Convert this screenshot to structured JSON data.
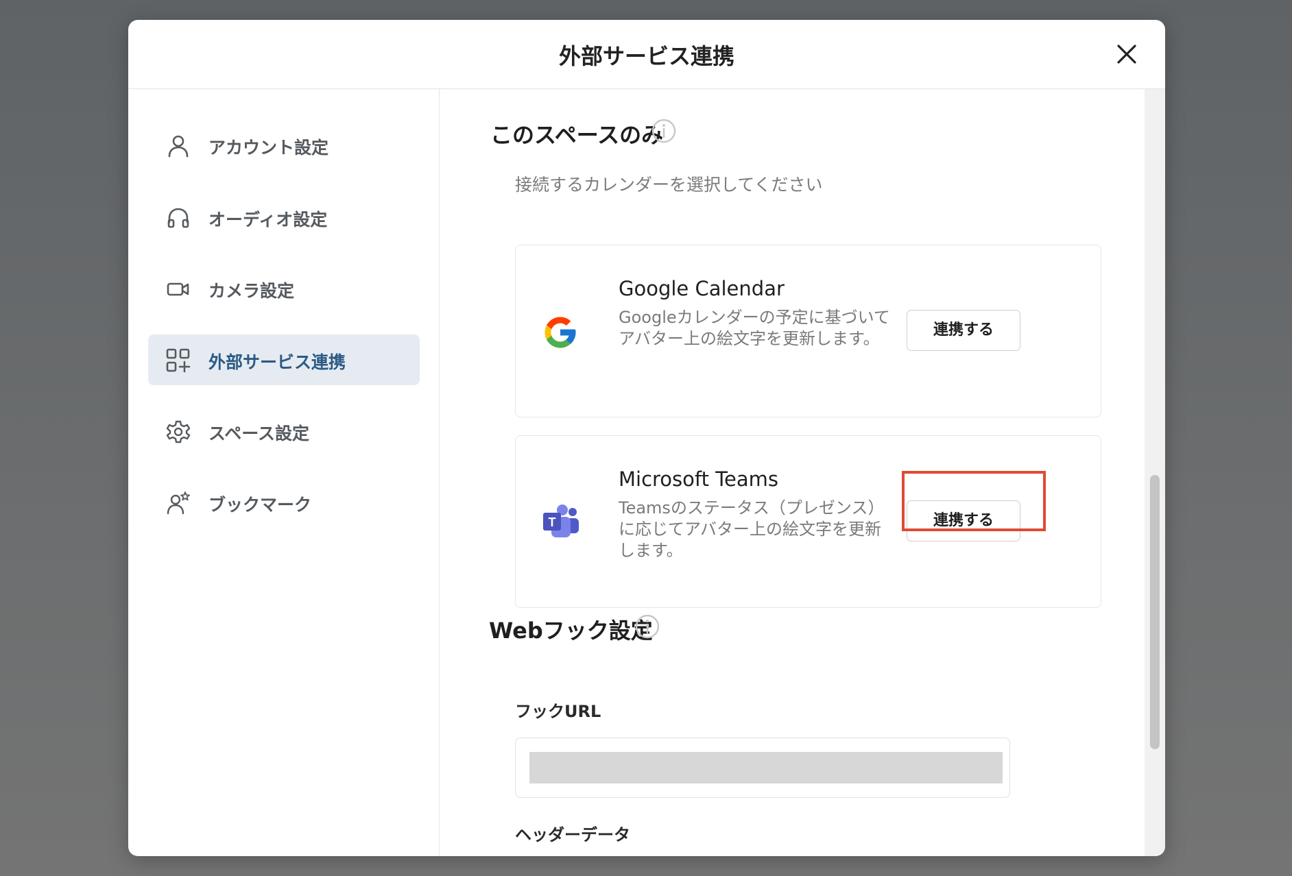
{
  "modal": {
    "title": "外部サービス連携",
    "close_icon": "close-icon"
  },
  "sidebar": {
    "items": [
      {
        "label": "アカウント設定",
        "icon": "user-icon",
        "active": false
      },
      {
        "label": "オーディオ設定",
        "icon": "headphones-icon",
        "active": false
      },
      {
        "label": "カメラ設定",
        "icon": "video-camera-icon",
        "active": false
      },
      {
        "label": "外部サービス連携",
        "icon": "apps-add-icon",
        "active": true
      },
      {
        "label": "スペース設定",
        "icon": "gear-icon",
        "active": false
      },
      {
        "label": "ブックマーク",
        "icon": "user-star-icon",
        "active": false
      }
    ]
  },
  "content": {
    "space_section": {
      "title": "このスペースのみ",
      "hint": "接続するカレンダーを選択してください"
    },
    "services": [
      {
        "name": "Google Calendar",
        "description": "Googleカレンダーの予定に基づいてアバター上の絵文字を更新します。",
        "button_label": "連携する",
        "logo": "google-logo-icon"
      },
      {
        "name": "Microsoft Teams",
        "description": "Teamsのステータス（プレゼンス）に応じてアバター上の絵文字を更新します。",
        "button_label": "連携する",
        "logo": "microsoft-teams-logo-icon"
      }
    ],
    "webhook_section": {
      "title": "Webフック設定",
      "hook_url_label": "フックURL",
      "header_data_label": "ヘッダーデータ"
    }
  },
  "colors": {
    "active_nav_bg": "#e5ebf1",
    "active_nav_text": "#2c5a86",
    "highlight": "#e04a33"
  }
}
